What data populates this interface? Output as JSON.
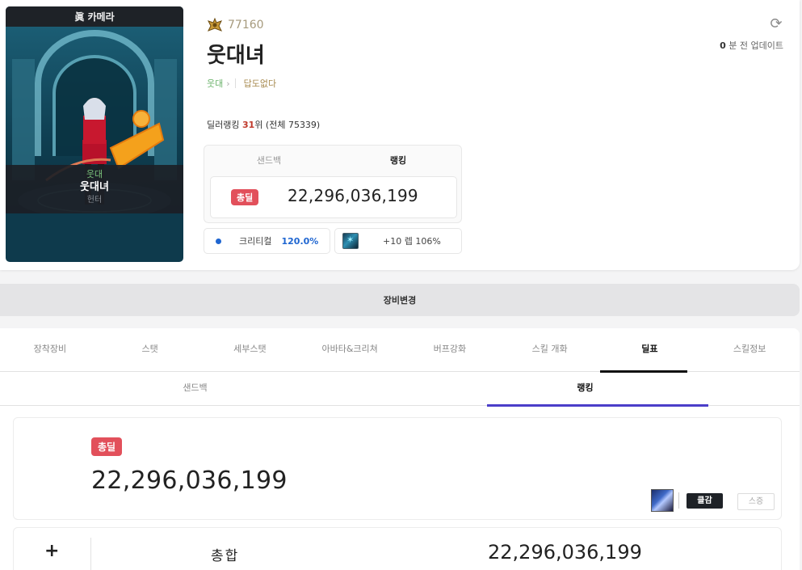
{
  "character": {
    "server": "眞 카메라",
    "adventure": "웃대",
    "name": "웃대녀",
    "job": "헌터",
    "fame": "77160"
  },
  "profile": {
    "tag_adventure": "웃대",
    "tag_guild": "답도없다",
    "update_num": "0",
    "update_suffix": "분 전 업데이트",
    "rank_prefix": "딜러랭킹 ",
    "rank_number": "31",
    "rank_suffix": "위 (전체 75339)"
  },
  "rank_box": {
    "tab_sandbag": "샌드백",
    "tab_ranking": "랭킹",
    "badge": "총딜",
    "value": "22,296,036,199"
  },
  "crit_pill": {
    "label": "크리티컬",
    "value": "120.0%"
  },
  "buff_pill": {
    "icon": "buff-skill-icon",
    "text": "+10 렙 106%"
  },
  "equip_change": "장비변경",
  "main_tabs": [
    "장착장비",
    "스탯",
    "세부스탯",
    "아바타&크리쳐",
    "버프강화",
    "스킬 개화",
    "딜표",
    "스킬정보"
  ],
  "sub_tabs": [
    "샌드백",
    "랭킹"
  ],
  "total_card": {
    "badge": "총딜",
    "value": "22,296,036,199",
    "btn_primary": "클감",
    "btn_secondary": "스증"
  },
  "sum_row": {
    "plus": "+",
    "label": "총합",
    "value": "22,296,036,199"
  },
  "colors": {
    "accent_red": "#e2505b",
    "accent_purple": "#4b3ec9",
    "crit_blue": "#1f66d1"
  }
}
